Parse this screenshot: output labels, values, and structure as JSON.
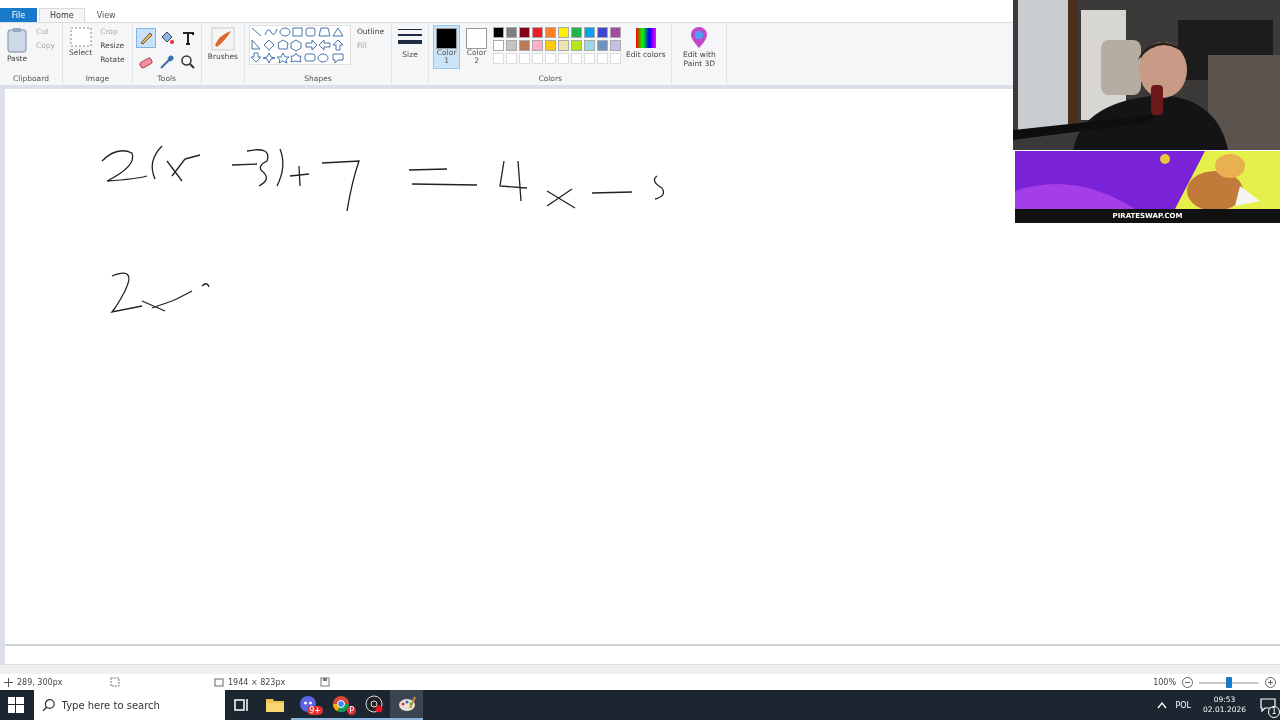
{
  "tabs": [
    {
      "label": "File",
      "kind": "file",
      "selected": false
    },
    {
      "label": "Home",
      "kind": "tab",
      "selected": true
    },
    {
      "label": "View",
      "kind": "tab",
      "selected": false
    }
  ],
  "clipboard": {
    "paste": "Paste",
    "cut": {
      "label": "Cut",
      "disabled": true
    },
    "copy": {
      "label": "Copy",
      "disabled": true
    },
    "group": "Clipboard"
  },
  "image": {
    "select": "Select",
    "crop": "Crop",
    "resize": "Resize",
    "rotate": "Rotate",
    "group": "Image"
  },
  "tools": {
    "group": "Tools"
  },
  "brushes": {
    "label": "Brushes"
  },
  "shapes": {
    "outline": "Outline",
    "fill": {
      "label": "Fill",
      "disabled": true
    },
    "group": "Shapes"
  },
  "size": {
    "label": "Size"
  },
  "color_slots": [
    {
      "label": "Color",
      "number": "1",
      "color": "#000000",
      "selected": true
    },
    {
      "label": "Color",
      "number": "2",
      "color": "#ffffff",
      "selected": false
    }
  ],
  "palette": [
    {
      "color": "#000000"
    },
    {
      "color": "#7f7f7f"
    },
    {
      "color": "#880015"
    },
    {
      "color": "#ed1c24"
    },
    {
      "color": "#ff7f27"
    },
    {
      "color": "#fff200"
    },
    {
      "color": "#22b14c"
    },
    {
      "color": "#00a2e8"
    },
    {
      "color": "#3f48cc"
    },
    {
      "color": "#a349a4"
    },
    {
      "color": "#ffffff"
    },
    {
      "color": "#c3c3c3"
    },
    {
      "color": "#b97a57"
    },
    {
      "color": "#ffaec9"
    },
    {
      "color": "#ffc90e"
    },
    {
      "color": "#efe4b0"
    },
    {
      "color": "#b5e61d"
    },
    {
      "color": "#99d9ea"
    },
    {
      "color": "#7092be"
    },
    {
      "color": "#c8bfe7"
    },
    {
      "kind": "empty"
    },
    {
      "kind": "empty"
    },
    {
      "kind": "empty"
    },
    {
      "kind": "empty"
    },
    {
      "kind": "empty"
    },
    {
      "kind": "empty"
    },
    {
      "kind": "empty"
    },
    {
      "kind": "empty"
    },
    {
      "kind": "empty"
    },
    {
      "kind": "empty"
    }
  ],
  "colors_group": "Colors",
  "edit_colors": "Edit colors",
  "paint3d": "Edit with Paint 3D",
  "overlay": {
    "banner_text": "PIRATESWAP.COM"
  },
  "status_bar": {
    "cursor": "289, 300px",
    "dimensions": "1944 × 823px",
    "zoom": "100%",
    "zoom_level": {
      "level": 0.5
    }
  },
  "taskbar": {
    "search_placeholder": "Type here to search",
    "apps": [
      {
        "kind": "taskview"
      },
      {
        "kind": "folder",
        "running": false
      },
      {
        "kind": "chat",
        "badge": "9+",
        "running": true
      },
      {
        "kind": "browser",
        "badge": "P",
        "running": true
      },
      {
        "kind": "recorder",
        "running": true
      },
      {
        "kind": "paint",
        "running": true,
        "selected": true
      }
    ],
    "language": "POL",
    "time": "09:53",
    "date": "02.01.2026",
    "notifications": "1"
  }
}
